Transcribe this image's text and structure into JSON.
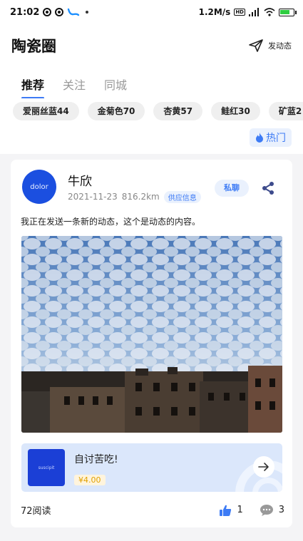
{
  "status_bar": {
    "time": "21:02",
    "net_speed": "1.2M/s",
    "net_badge": "HD"
  },
  "header": {
    "title": "陶瓷圈",
    "post_label": "发动态"
  },
  "tabs": [
    {
      "label": "推荐",
      "active": true
    },
    {
      "label": "关注",
      "active": false
    },
    {
      "label": "同城",
      "active": false
    }
  ],
  "chips": [
    "爱丽丝蓝44",
    "金菊色70",
    "杏黄57",
    "鲑红30",
    "矿蓝2"
  ],
  "hot_label": "热门",
  "post": {
    "avatar_text": "dolor",
    "author": "牛欣",
    "date": "2021-11-23",
    "distance": "816.2km",
    "tag": "供应信息",
    "chat_label": "私聊",
    "content": "我正在发送一条新的动态，这个是动态的内容。",
    "product": {
      "thumb_text": "suscipit",
      "name": "自讨苦吃!",
      "price": "¥4.00"
    },
    "reads": "72阅读",
    "likes": "1",
    "comments": "3"
  },
  "colors": {
    "accent": "#3d7bf5",
    "avatar_bg": "#1b4fe0",
    "price": "#e0a100"
  }
}
